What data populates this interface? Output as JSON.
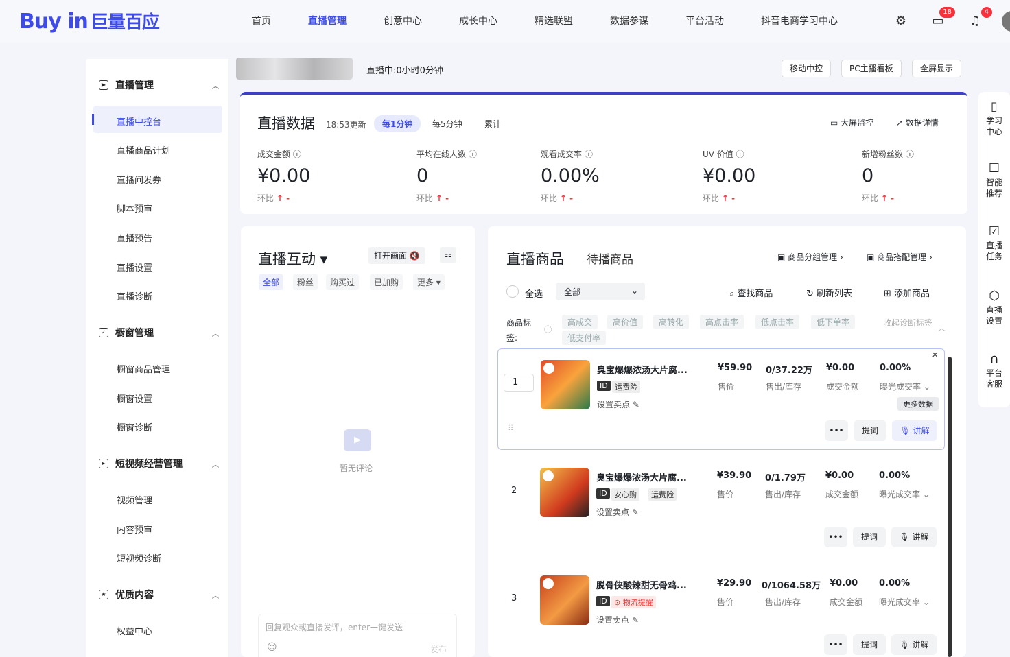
{
  "brand": {
    "logo_text": "Buy in",
    "logo_cn": "巨量百应"
  },
  "nav": [
    "首页",
    "直播管理",
    "创意中心",
    "成长中心",
    "精选联盟",
    "数据参谋",
    "平台活动",
    "抖音电商学习中心"
  ],
  "top_icons": {
    "settings": "gear-icon",
    "messages": "chat-icon",
    "messages_badge": "18",
    "bell": "bell-icon",
    "bell_badge": "4"
  },
  "sidebar": {
    "sections": [
      {
        "title": "直播管理",
        "items": [
          "直播中控台",
          "直播商品计划",
          "直播间发券",
          "脚本预审",
          "直播预告",
          "直播设置",
          "直播诊断"
        ]
      },
      {
        "title": "橱窗管理",
        "items": [
          "橱窗商品管理",
          "橱窗设置",
          "橱窗诊断"
        ]
      },
      {
        "title": "短视频经营管理",
        "items": [
          "视频管理",
          "内容预审",
          "短视频诊断"
        ]
      },
      {
        "title": "优质内容",
        "items": [
          "权益中心"
        ]
      }
    ]
  },
  "header": {
    "live_status": "直播中:0小时0分钟",
    "buttons": [
      "移动中控",
      "PC主播看板",
      "全屏显示"
    ]
  },
  "live_data": {
    "title": "直播数据",
    "updated": "18:53更新",
    "tabs": [
      "每1分钟",
      "每5分钟",
      "累计"
    ],
    "actions": [
      "大屏监控",
      "数据详情"
    ],
    "metrics": [
      {
        "label": "成交金额",
        "value": "¥0.00",
        "compare": "环比"
      },
      {
        "label": "平均在线人数",
        "value": "0",
        "compare": "环比"
      },
      {
        "label": "观看成交率",
        "value": "0.00%",
        "compare": "环比"
      },
      {
        "label": "UV 价值",
        "value": "¥0.00",
        "compare": "环比"
      },
      {
        "label": "新增粉丝数",
        "value": "0",
        "compare": "环比"
      }
    ],
    "trend": "↑ -"
  },
  "interaction": {
    "title": "直播互动",
    "open_btn": "打开画面",
    "filters": [
      "全部",
      "粉丝",
      "购买过",
      "已加购",
      "更多"
    ],
    "empty": "暂无评论",
    "input_placeholder": "回复观众或直接发评，enter一键发送",
    "send": "发布"
  },
  "products": {
    "tab_active": "直播商品",
    "tab_other": "待播商品",
    "group_mgr": "商品分组管理",
    "combo_mgr": "商品搭配管理",
    "select_all": "全选",
    "dropdown": "全部",
    "search": "查找商品",
    "refresh": "刷新列表",
    "add": "添加商品",
    "tag_label": "商品标签:",
    "tags": [
      "高成交",
      "高价值",
      "高转化",
      "高点击率",
      "低点击率",
      "低下单率",
      "低支付率"
    ],
    "collapse": "收起诊断标签",
    "items": [
      {
        "index": "1",
        "name": "臭宝爆爆浓汤大片腐...",
        "tags": [
          "ID",
          "运费险"
        ],
        "price": "¥59.90",
        "price_lb": "售价",
        "sold": "0/37.22万",
        "sold_lb": "售出/库存",
        "gmv": "¥0.00",
        "gmv_lb": "成交金额",
        "rate": "0.00%",
        "rate_lb": "曝光成交率",
        "setpoint": "设置卖点",
        "more_data": "更多数据",
        "btn_more": "•••",
        "btn_prompt": "提词",
        "btn_explain": "讲解"
      },
      {
        "index": "2",
        "name": "臭宝爆爆浓汤大片腐...",
        "tags": [
          "ID",
          "安心购",
          "运费险"
        ],
        "price": "¥39.90",
        "price_lb": "售价",
        "sold": "0/1.79万",
        "sold_lb": "售出/库存",
        "gmv": "¥0.00",
        "gmv_lb": "成交金额",
        "rate": "0.00%",
        "rate_lb": "曝光成交率",
        "setpoint": "设置卖点",
        "btn_more": "•••",
        "btn_prompt": "提词",
        "btn_explain": "讲解"
      },
      {
        "index": "3",
        "name": "脱骨侠酸辣甜无骨鸡...",
        "tags": [
          "ID",
          "物流提醒"
        ],
        "price": "¥29.90",
        "price_lb": "售价",
        "sold": "0/1064.58万",
        "sold_lb": "售出/库存",
        "gmv": "¥0.00",
        "gmv_lb": "成交金额",
        "rate": "0.00%",
        "rate_lb": "曝光成交率",
        "setpoint": "设置卖点",
        "btn_more": "•••",
        "btn_prompt": "提词",
        "btn_explain": "讲解"
      }
    ]
  },
  "rightbar": [
    "学习中心",
    "智能推荐",
    "直播任务",
    "直播设置",
    "平台客服"
  ],
  "colors": {
    "accent": "#3e4be6",
    "danger": "#f5313b"
  }
}
